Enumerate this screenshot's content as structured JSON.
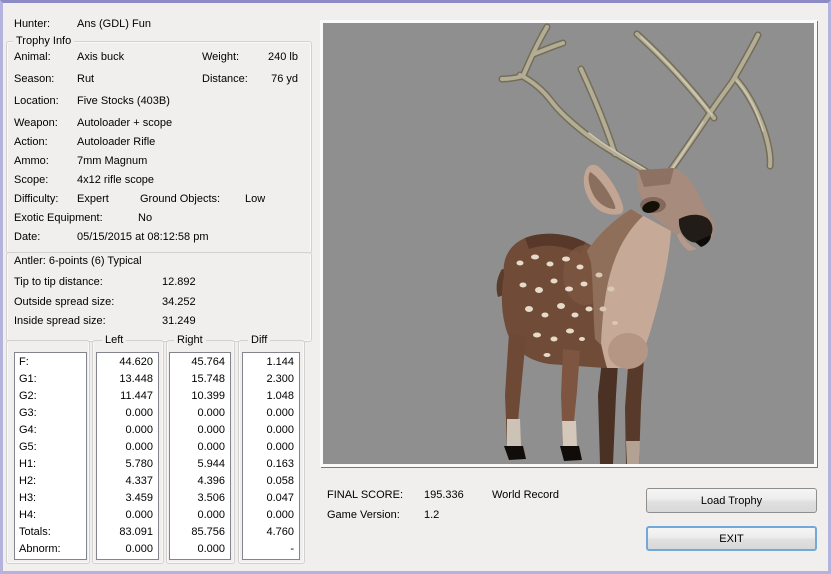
{
  "header": {
    "hunter_label": "Hunter:",
    "hunter_value": "Ans (GDL) Fun"
  },
  "trophy_info": {
    "caption": "Trophy Info",
    "animal_label": "Animal:",
    "animal_value": "Axis buck",
    "weight_label": "Weight:",
    "weight_value": "240 lb",
    "season_label": "Season:",
    "season_value": "Rut",
    "distance_label": "Distance:",
    "distance_value": "76 yd",
    "location_label": "Location:",
    "location_value": "Five Stocks (403B)",
    "weapon_label": "Weapon:",
    "weapon_value": "Autoloader + scope",
    "action_label": "Action:",
    "action_value": "Autoloader Rifle",
    "ammo_label": "Ammo:",
    "ammo_value": "7mm Magnum",
    "scope_label": "Scope:",
    "scope_value": "4x12 rifle scope",
    "difficulty_label": "Difficulty:",
    "difficulty_value": "Expert",
    "ground_objects_label": "Ground Objects:",
    "ground_objects_value": "Low",
    "exotic_label": "Exotic Equipment:",
    "exotic_value": "No",
    "date_label": "Date:",
    "date_value": "05/15/2015 at 08:12:58 pm"
  },
  "antler_info": {
    "line": "Antler: 6-points (6) Typical",
    "tip_label": "Tip to tip distance:",
    "tip_value": "12.892",
    "outside_label": "Outside spread size:",
    "outside_value": "34.252",
    "inside_label": "Inside spread size:",
    "inside_value": "31.249"
  },
  "measurements": {
    "columns": {
      "left": "Left",
      "right": "Right",
      "diff": "Diff"
    },
    "rows": [
      {
        "label": "F:",
        "left": "44.620",
        "right": "45.764",
        "diff": "1.144"
      },
      {
        "label": "G1:",
        "left": "13.448",
        "right": "15.748",
        "diff": "2.300"
      },
      {
        "label": "G2:",
        "left": "11.447",
        "right": "10.399",
        "diff": "1.048"
      },
      {
        "label": "G3:",
        "left": "0.000",
        "right": "0.000",
        "diff": "0.000"
      },
      {
        "label": "G4:",
        "left": "0.000",
        "right": "0.000",
        "diff": "0.000"
      },
      {
        "label": "G5:",
        "left": "0.000",
        "right": "0.000",
        "diff": "0.000"
      },
      {
        "label": "H1:",
        "left": "5.780",
        "right": "5.944",
        "diff": "0.163"
      },
      {
        "label": "H2:",
        "left": "4.337",
        "right": "4.396",
        "diff": "0.058"
      },
      {
        "label": "H3:",
        "left": "3.459",
        "right": "3.506",
        "diff": "0.047"
      },
      {
        "label": "H4:",
        "left": "0.000",
        "right": "0.000",
        "diff": "0.000"
      },
      {
        "label": "Totals:",
        "left": "83.091",
        "right": "85.756",
        "diff": "4.760"
      },
      {
        "label": "Abnorm:",
        "left": "0.000",
        "right": "0.000",
        "diff": "-"
      }
    ]
  },
  "score": {
    "final_label": "FINAL SCORE:",
    "final_value": "195.336",
    "final_rank": "World Record",
    "version_label": "Game Version:",
    "version_value": "1.2"
  },
  "buttons": {
    "load_trophy": "Load Trophy",
    "exit": "EXIT"
  },
  "viewport": {
    "subject": "Axis buck 3D trophy render",
    "background_color": "#8f8f8f"
  },
  "colors": {
    "window_border": "#b4b3dd",
    "background": "#f0efed",
    "focus_border": "#71aad9"
  }
}
